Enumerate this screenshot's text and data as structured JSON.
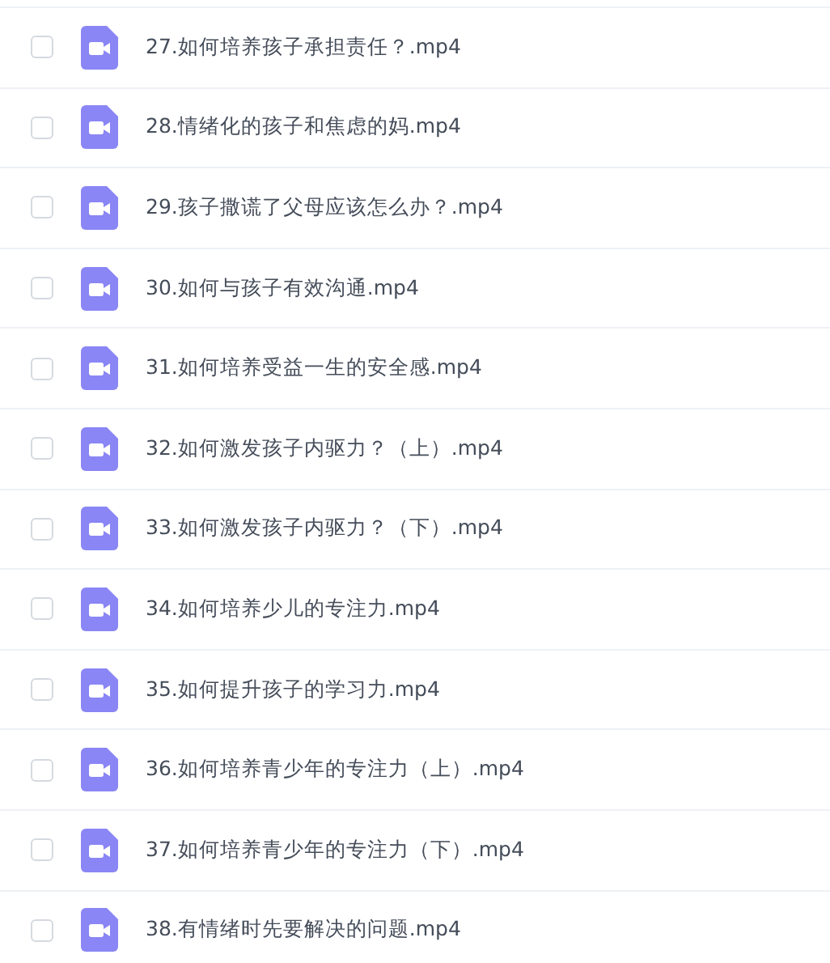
{
  "files": [
    {
      "name": "27.如何培养孩子承担责任？.mp4",
      "checked": false
    },
    {
      "name": "28.情绪化的孩子和焦虑的妈.mp4",
      "checked": false
    },
    {
      "name": "29.孩子撒谎了父母应该怎么办？.mp4",
      "checked": false
    },
    {
      "name": "30.如何与孩子有效沟通.mp4",
      "checked": false
    },
    {
      "name": "31.如何培养受益一生的安全感.mp4",
      "checked": false
    },
    {
      "name": "32.如何激发孩子内驱力？（上）.mp4",
      "checked": false
    },
    {
      "name": "33.如何激发孩子内驱力？（下）.mp4",
      "checked": false
    },
    {
      "name": "34.如何培养少儿的专注力.mp4",
      "checked": false
    },
    {
      "name": "35.如何提升孩子的学习力.mp4",
      "checked": false
    },
    {
      "name": "36.如何培养青少年的专注力（上）.mp4",
      "checked": false
    },
    {
      "name": "37.如何培养青少年的专注力（下）.mp4",
      "checked": false
    },
    {
      "name": "38.有情绪时先要解决的问题.mp4",
      "checked": false
    }
  ]
}
